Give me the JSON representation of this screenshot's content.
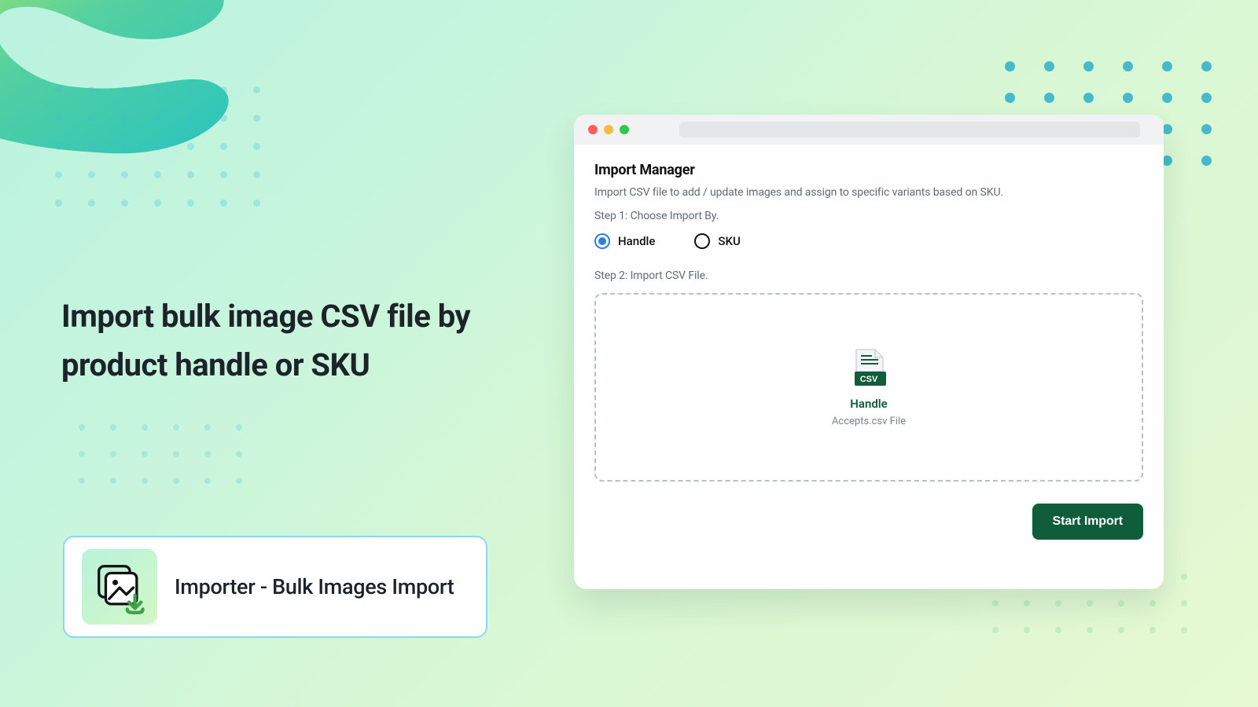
{
  "headline": "Import bulk image CSV file by product handle or SKU",
  "badge": {
    "label": "Importer - Bulk Images Import"
  },
  "window": {
    "title": "Import Manager",
    "description": "Import CSV file to add / update images and assign to specific  variants based on SKU.",
    "step1_label": "Step 1: Choose Import By.",
    "radio_handle": "Handle",
    "radio_sku": "SKU",
    "step2_label": "Step 2: Import CSV File.",
    "dropzone_label": "Handle",
    "dropzone_sub": "Accepts.csv File",
    "start_button": "Start Import"
  },
  "icons": {
    "csv_badge": "CSV"
  }
}
